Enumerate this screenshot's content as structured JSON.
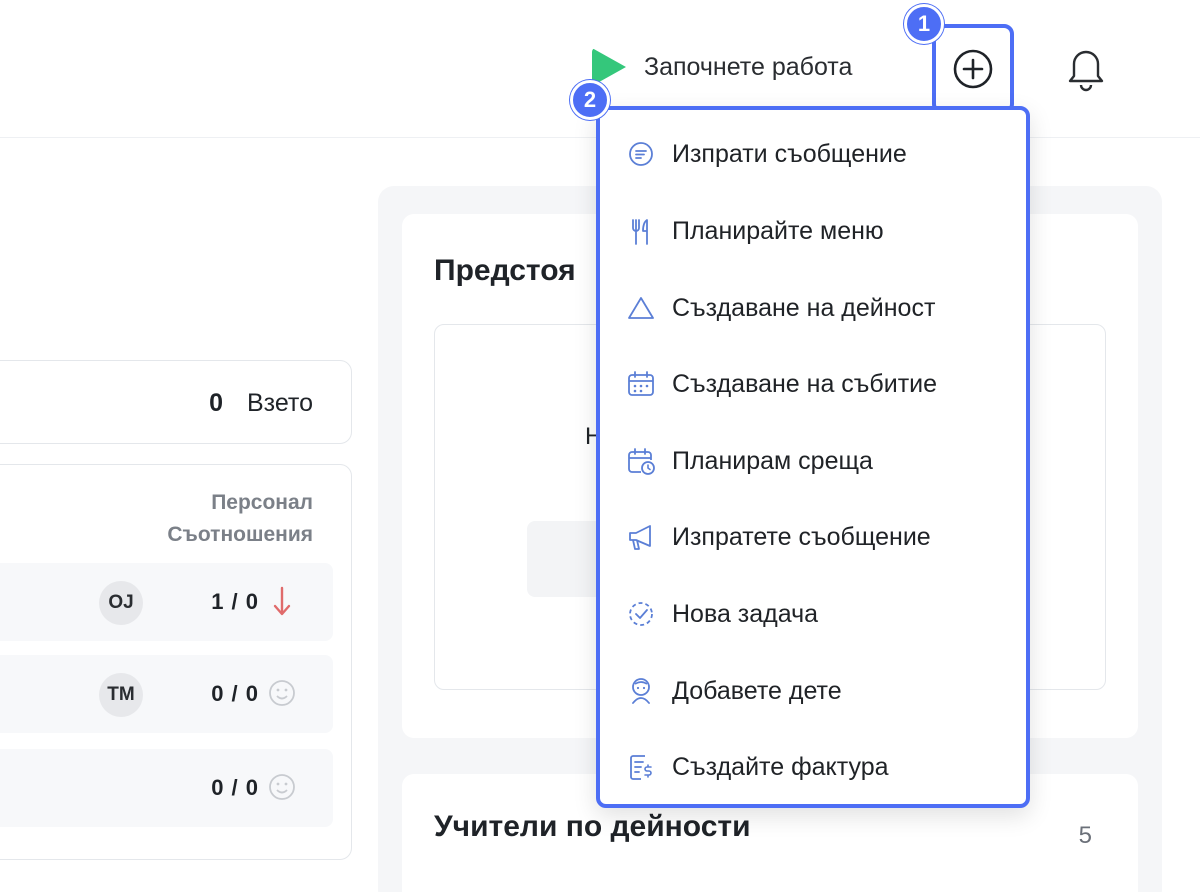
{
  "header": {
    "get_started_label": "Започнете работа",
    "accent_color": "#34c77b"
  },
  "annotations": {
    "badge_1": "1",
    "badge_2": "2",
    "highlight_color": "#4d6ef5"
  },
  "attendance": {
    "taken_count": "0",
    "taken_label": "Взето"
  },
  "staff": {
    "header_line1": "Персонал",
    "header_line2": "Съотношения",
    "rows": [
      {
        "initials": "OJ",
        "ratio": "1 / 0",
        "status": "down-arrow-icon"
      },
      {
        "initials": "TM",
        "ratio": "0 / 0",
        "status": "smiley-icon"
      },
      {
        "initials": "",
        "ratio": "0 / 0",
        "status": "smiley-icon"
      }
    ]
  },
  "upcoming": {
    "title": "Предстоя",
    "fragment": "Н"
  },
  "teachers": {
    "title": "Учители по дейности",
    "count": "5"
  },
  "menu": {
    "items": [
      {
        "label": "Изпрати съобщение",
        "icon": "message-icon"
      },
      {
        "label": "Планирайте меню",
        "icon": "fork-knife-icon"
      },
      {
        "label": "Създаване на дейност",
        "icon": "triangle-icon"
      },
      {
        "label": "Създаване на събитие",
        "icon": "calendar-icon"
      },
      {
        "label": "Планирам среща",
        "icon": "calendar-clock-icon"
      },
      {
        "label": "Изпратете съобщение",
        "icon": "megaphone-icon"
      },
      {
        "label": "Нова задача",
        "icon": "task-check-icon"
      },
      {
        "label": "Добавете дете",
        "icon": "child-icon"
      },
      {
        "label": "Създайте фактура",
        "icon": "invoice-icon"
      }
    ]
  }
}
